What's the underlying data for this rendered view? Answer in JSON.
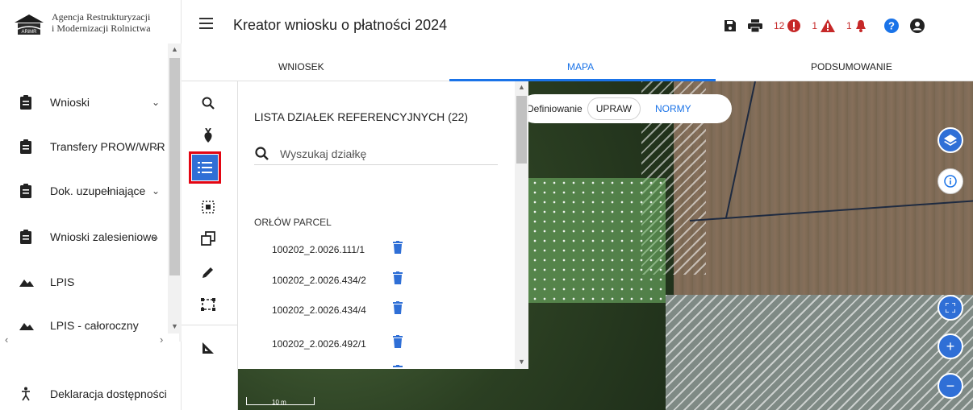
{
  "app": {
    "logo_line1": "Agencja Restrukturyzacji",
    "logo_line2": "i Modernizacji Rolnictwa",
    "logo_badge": "ARiMR",
    "title": "Kreator wniosku o płatności 2024"
  },
  "toolbar": {
    "error_count": "12",
    "warning_count": "1",
    "notification_count": "1",
    "icons": [
      "save-icon",
      "print-icon",
      "error-icon",
      "warning-icon",
      "bell-icon",
      "help-icon",
      "user-icon"
    ],
    "colors": {
      "error": "#c62828",
      "help": "#1a73e8"
    }
  },
  "sidebar": {
    "items": [
      {
        "label": "Wnioski",
        "icon": "clipboard-icon",
        "chevron": "⌄"
      },
      {
        "label": "Transfery PROW/WPR",
        "icon": "clipboard-icon",
        "chevron": "⌄"
      },
      {
        "label": "Dok. uzupełniające",
        "icon": "clipboard-icon",
        "chevron": "⌄"
      },
      {
        "label": "Wnioski zalesieniowe",
        "icon": "clipboard-icon",
        "chevron": "⌄"
      },
      {
        "label": "LPIS",
        "icon": "mountain-icon"
      },
      {
        "label": "LPIS - całoroczny",
        "icon": "mountain-icon"
      }
    ],
    "footer_label": "Deklaracja dostępności"
  },
  "tabs": [
    {
      "label": "WNIOSEK",
      "active": false
    },
    {
      "label": "MAPA",
      "active": true
    },
    {
      "label": "PODSUMOWANIE",
      "active": false
    }
  ],
  "tools": [
    "search-icon",
    "beet-icon",
    "list-icon",
    "select-area-icon",
    "copy-geometry-icon",
    "pencil-icon",
    "dashed-rectangle-icon",
    "measure-icon"
  ],
  "panel": {
    "title": "LISTA DZIAŁEK REFERENCYJNYCH (22)",
    "search_placeholder": "Wyszukaj działkę",
    "group_label": "ORŁÓW PARCEL",
    "parcels": [
      "100202_2.0026.111/1",
      "100202_2.0026.434/2",
      "100202_2.0026.434/4",
      "100202_2.0026.492/1"
    ]
  },
  "map": {
    "define_label": "Definiowanie",
    "upraw_label": "UPRAW",
    "normy_label": "NORMY",
    "scale_label": "10 m",
    "buttons": [
      "layers-icon",
      "info-icon",
      "fullscreen-icon",
      "zoom-in-icon",
      "zoom-out-icon"
    ],
    "zoom_in": "+",
    "zoom_out": "−"
  }
}
